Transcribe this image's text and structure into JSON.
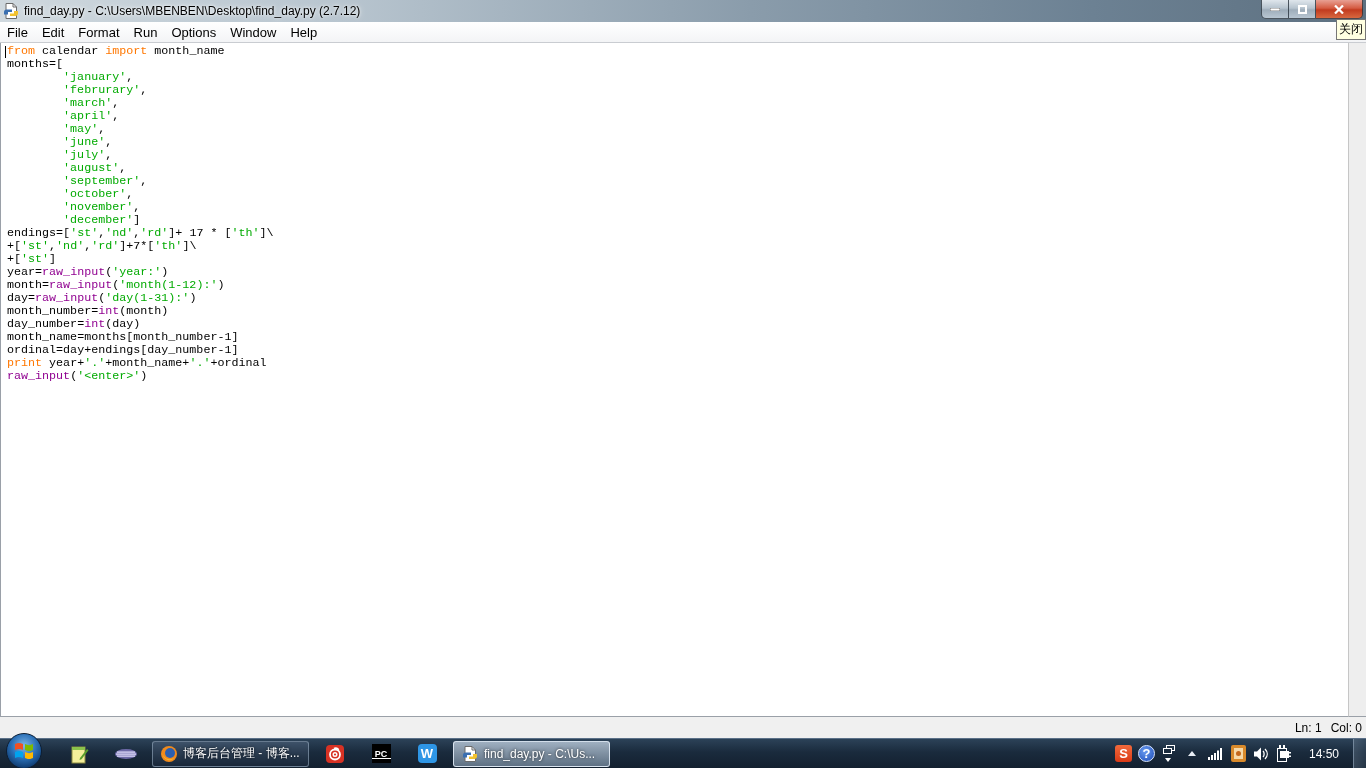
{
  "window": {
    "title": "find_day.py - C:\\Users\\MBENBEN\\Desktop\\find_day.py (2.7.12)",
    "close_tooltip": "关闭"
  },
  "menu": [
    "File",
    "Edit",
    "Format",
    "Run",
    "Options",
    "Window",
    "Help"
  ],
  "editor": {
    "lines": [
      {
        "tokens": [
          {
            "kind": "keyword",
            "text": "from"
          },
          {
            "kind": "plain",
            "text": " calendar "
          },
          {
            "kind": "keyword",
            "text": "import"
          },
          {
            "kind": "plain",
            "text": " month_name"
          }
        ]
      },
      {
        "tokens": [
          {
            "kind": "plain",
            "text": "months=["
          }
        ],
        "children": [
          {
            "tokens": [
              {
                "kind": "string",
                "text": "'january'"
              },
              {
                "kind": "plain",
                "text": ","
              }
            ]
          },
          {
            "tokens": [
              {
                "kind": "string",
                "text": "'februrary'"
              },
              {
                "kind": "plain",
                "text": ","
              }
            ]
          },
          {
            "tokens": [
              {
                "kind": "string",
                "text": "'march'"
              },
              {
                "kind": "plain",
                "text": ","
              }
            ]
          },
          {
            "tokens": [
              {
                "kind": "string",
                "text": "'april'"
              },
              {
                "kind": "plain",
                "text": ","
              }
            ]
          },
          {
            "tokens": [
              {
                "kind": "string",
                "text": "'may'"
              },
              {
                "kind": "plain",
                "text": ","
              }
            ]
          },
          {
            "tokens": [
              {
                "kind": "string",
                "text": "'june'"
              },
              {
                "kind": "plain",
                "text": ","
              }
            ]
          },
          {
            "tokens": [
              {
                "kind": "string",
                "text": "'july'"
              },
              {
                "kind": "plain",
                "text": ","
              }
            ]
          },
          {
            "tokens": [
              {
                "kind": "string",
                "text": "'august'"
              },
              {
                "kind": "plain",
                "text": ","
              }
            ]
          },
          {
            "tokens": [
              {
                "kind": "string",
                "text": "'september'"
              },
              {
                "kind": "plain",
                "text": ","
              }
            ]
          },
          {
            "tokens": [
              {
                "kind": "string",
                "text": "'october'"
              },
              {
                "kind": "plain",
                "text": ","
              }
            ]
          },
          {
            "tokens": [
              {
                "kind": "string",
                "text": "'november'"
              },
              {
                "kind": "plain",
                "text": ","
              }
            ]
          },
          {
            "tokens": [
              {
                "kind": "string",
                "text": "'december'"
              },
              {
                "kind": "plain",
                "text": "]"
              }
            ]
          }
        ]
      },
      {
        "tokens": [
          {
            "kind": "plain",
            "text": "endings=["
          },
          {
            "kind": "string",
            "text": "'st'"
          },
          {
            "kind": "plain",
            "text": ","
          },
          {
            "kind": "string",
            "text": "'nd'"
          },
          {
            "kind": "plain",
            "text": ","
          },
          {
            "kind": "string",
            "text": "'rd'"
          },
          {
            "kind": "plain",
            "text": "]+ 17 * ["
          },
          {
            "kind": "string",
            "text": "'th'"
          },
          {
            "kind": "plain",
            "text": "]\\"
          }
        ]
      },
      {
        "tokens": [
          {
            "kind": "plain",
            "text": "+["
          },
          {
            "kind": "string",
            "text": "'st'"
          },
          {
            "kind": "plain",
            "text": ","
          },
          {
            "kind": "string",
            "text": "'nd'"
          },
          {
            "kind": "plain",
            "text": ","
          },
          {
            "kind": "string",
            "text": "'rd'"
          },
          {
            "kind": "plain",
            "text": "]+7*["
          },
          {
            "kind": "string",
            "text": "'th'"
          },
          {
            "kind": "plain",
            "text": "]\\"
          }
        ]
      },
      {
        "tokens": [
          {
            "kind": "plain",
            "text": "+["
          },
          {
            "kind": "string",
            "text": "'st'"
          },
          {
            "kind": "plain",
            "text": "]"
          }
        ]
      },
      {
        "tokens": [
          {
            "kind": "plain",
            "text": "year="
          },
          {
            "kind": "builtin",
            "text": "raw_input"
          },
          {
            "kind": "plain",
            "text": "("
          },
          {
            "kind": "string",
            "text": "'year:'"
          },
          {
            "kind": "plain",
            "text": ")"
          }
        ]
      },
      {
        "tokens": [
          {
            "kind": "plain",
            "text": "month="
          },
          {
            "kind": "builtin",
            "text": "raw_input"
          },
          {
            "kind": "plain",
            "text": "("
          },
          {
            "kind": "string",
            "text": "'month(1-12):'"
          },
          {
            "kind": "plain",
            "text": ")"
          }
        ]
      },
      {
        "tokens": [
          {
            "kind": "plain",
            "text": "day="
          },
          {
            "kind": "builtin",
            "text": "raw_input"
          },
          {
            "kind": "plain",
            "text": "("
          },
          {
            "kind": "string",
            "text": "'day(1-31):'"
          },
          {
            "kind": "plain",
            "text": ")"
          }
        ]
      },
      {
        "tokens": [
          {
            "kind": "plain",
            "text": "month_number="
          },
          {
            "kind": "builtin",
            "text": "int"
          },
          {
            "kind": "plain",
            "text": "(month)"
          }
        ]
      },
      {
        "tokens": [
          {
            "kind": "plain",
            "text": "day_number="
          },
          {
            "kind": "builtin",
            "text": "int"
          },
          {
            "kind": "plain",
            "text": "(day)"
          }
        ]
      },
      {
        "tokens": [
          {
            "kind": "plain",
            "text": "month_name=months[month_number-1]"
          }
        ]
      },
      {
        "tokens": [
          {
            "kind": "plain",
            "text": "ordinal=day+endings[day_number-1]"
          }
        ]
      },
      {
        "tokens": [
          {
            "kind": "keyword",
            "text": "print"
          },
          {
            "kind": "plain",
            "text": " year+"
          },
          {
            "kind": "string",
            "text": "'.'"
          },
          {
            "kind": "plain",
            "text": "+month_name+"
          },
          {
            "kind": "string",
            "text": "'.'"
          },
          {
            "kind": "plain",
            "text": "+ordinal"
          }
        ]
      },
      {
        "tokens": [
          {
            "kind": "builtin",
            "text": "raw_input"
          },
          {
            "kind": "plain",
            "text": "("
          },
          {
            "kind": "string",
            "text": "'<enter>'"
          },
          {
            "kind": "plain",
            "text": ")"
          }
        ]
      }
    ]
  },
  "status_bar": {
    "line": "Ln: 1",
    "column": "Col: 0"
  },
  "taskbar": {
    "items": [
      {
        "kind": "notes"
      },
      {
        "kind": "lines"
      },
      {
        "kind": "browser",
        "label": "博客后台管理 - 博客...",
        "selected": false
      },
      {
        "kind": "music"
      },
      {
        "kind": "ide",
        "text": "PC"
      },
      {
        "kind": "writer",
        "text": "W"
      },
      {
        "kind": "editor",
        "label": "find_day.py - C:\\Us...",
        "selected": true
      }
    ],
    "tray": [
      {
        "kind": "ime",
        "text": "S"
      },
      {
        "kind": "help",
        "text": "?"
      },
      {
        "kind": "display"
      },
      {
        "kind": "expand"
      },
      {
        "kind": "signal"
      },
      {
        "kind": "app"
      },
      {
        "kind": "volume"
      },
      {
        "kind": "power"
      }
    ],
    "clock": "14:50"
  }
}
